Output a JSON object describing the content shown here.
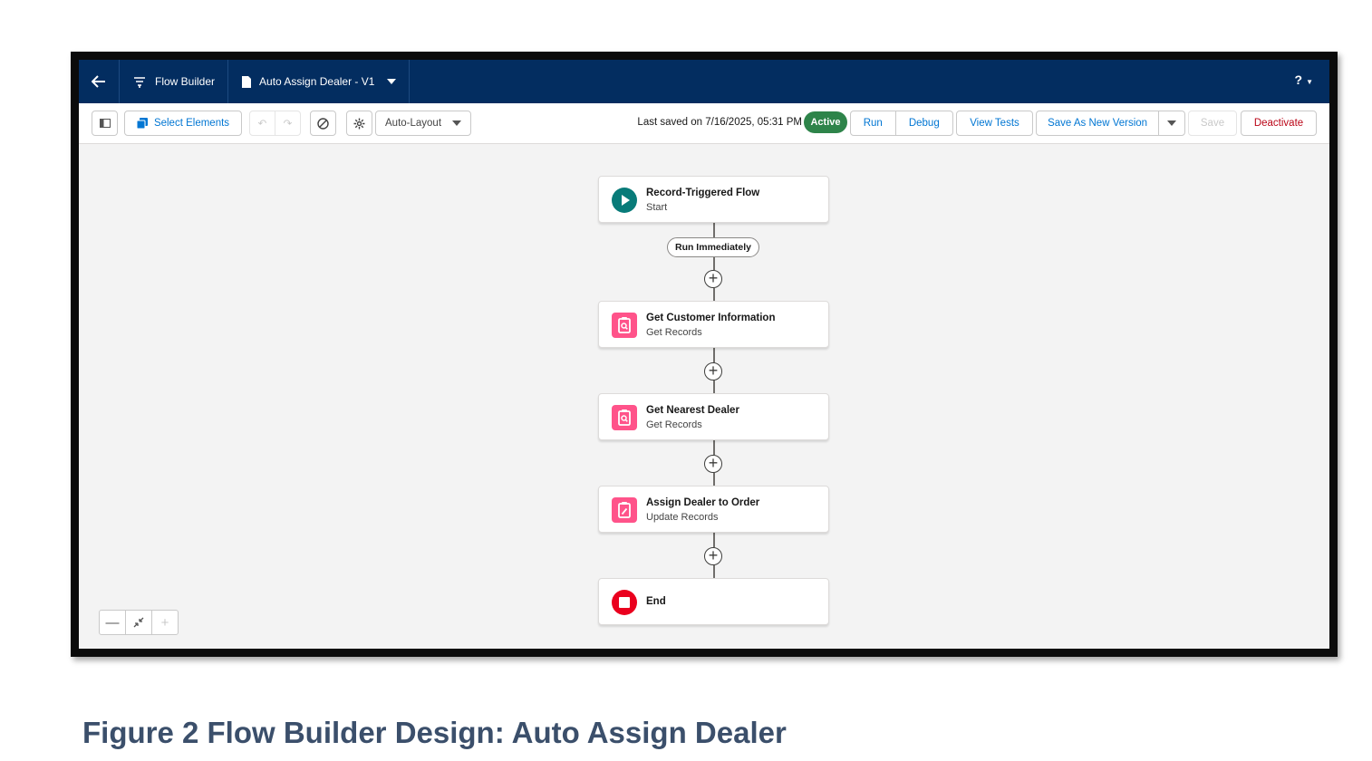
{
  "nav": {
    "app_name": "Flow Builder",
    "flow_name": "Auto Assign Dealer - V1",
    "help_label": "?"
  },
  "toolbar": {
    "select_elements": "Select Elements",
    "layout_mode": "Auto-Layout",
    "last_saved": "Last saved on 7/16/2025, 05:31 PM",
    "status": "Active",
    "run": "Run",
    "debug": "Debug",
    "view_tests": "View Tests",
    "save_as_new_version": "Save As New Version",
    "save": "Save",
    "deactivate": "Deactivate"
  },
  "flow": {
    "start": {
      "title": "Record-Triggered Flow",
      "subtitle": "Start"
    },
    "path_label": "Run Immediately",
    "elements": [
      {
        "title": "Get Customer Information",
        "subtitle": "Get Records",
        "icon": "get-records-icon"
      },
      {
        "title": "Get Nearest Dealer",
        "subtitle": "Get Records",
        "icon": "get-records-icon"
      },
      {
        "title": "Assign Dealer to Order",
        "subtitle": "Update Records",
        "icon": "update-records-icon"
      }
    ],
    "end": {
      "title": "End"
    }
  },
  "colors": {
    "nav_bg": "#032d60",
    "accent": "#0176d3",
    "active_badge": "#2e844a",
    "start_icon": "#087b79",
    "records_icon": "#ff538a",
    "end_icon": "#ea001e",
    "danger": "#ba0517",
    "caption": "#3b4f6b"
  },
  "caption": "Figure 2 Flow Builder Design: Auto Assign Dealer"
}
